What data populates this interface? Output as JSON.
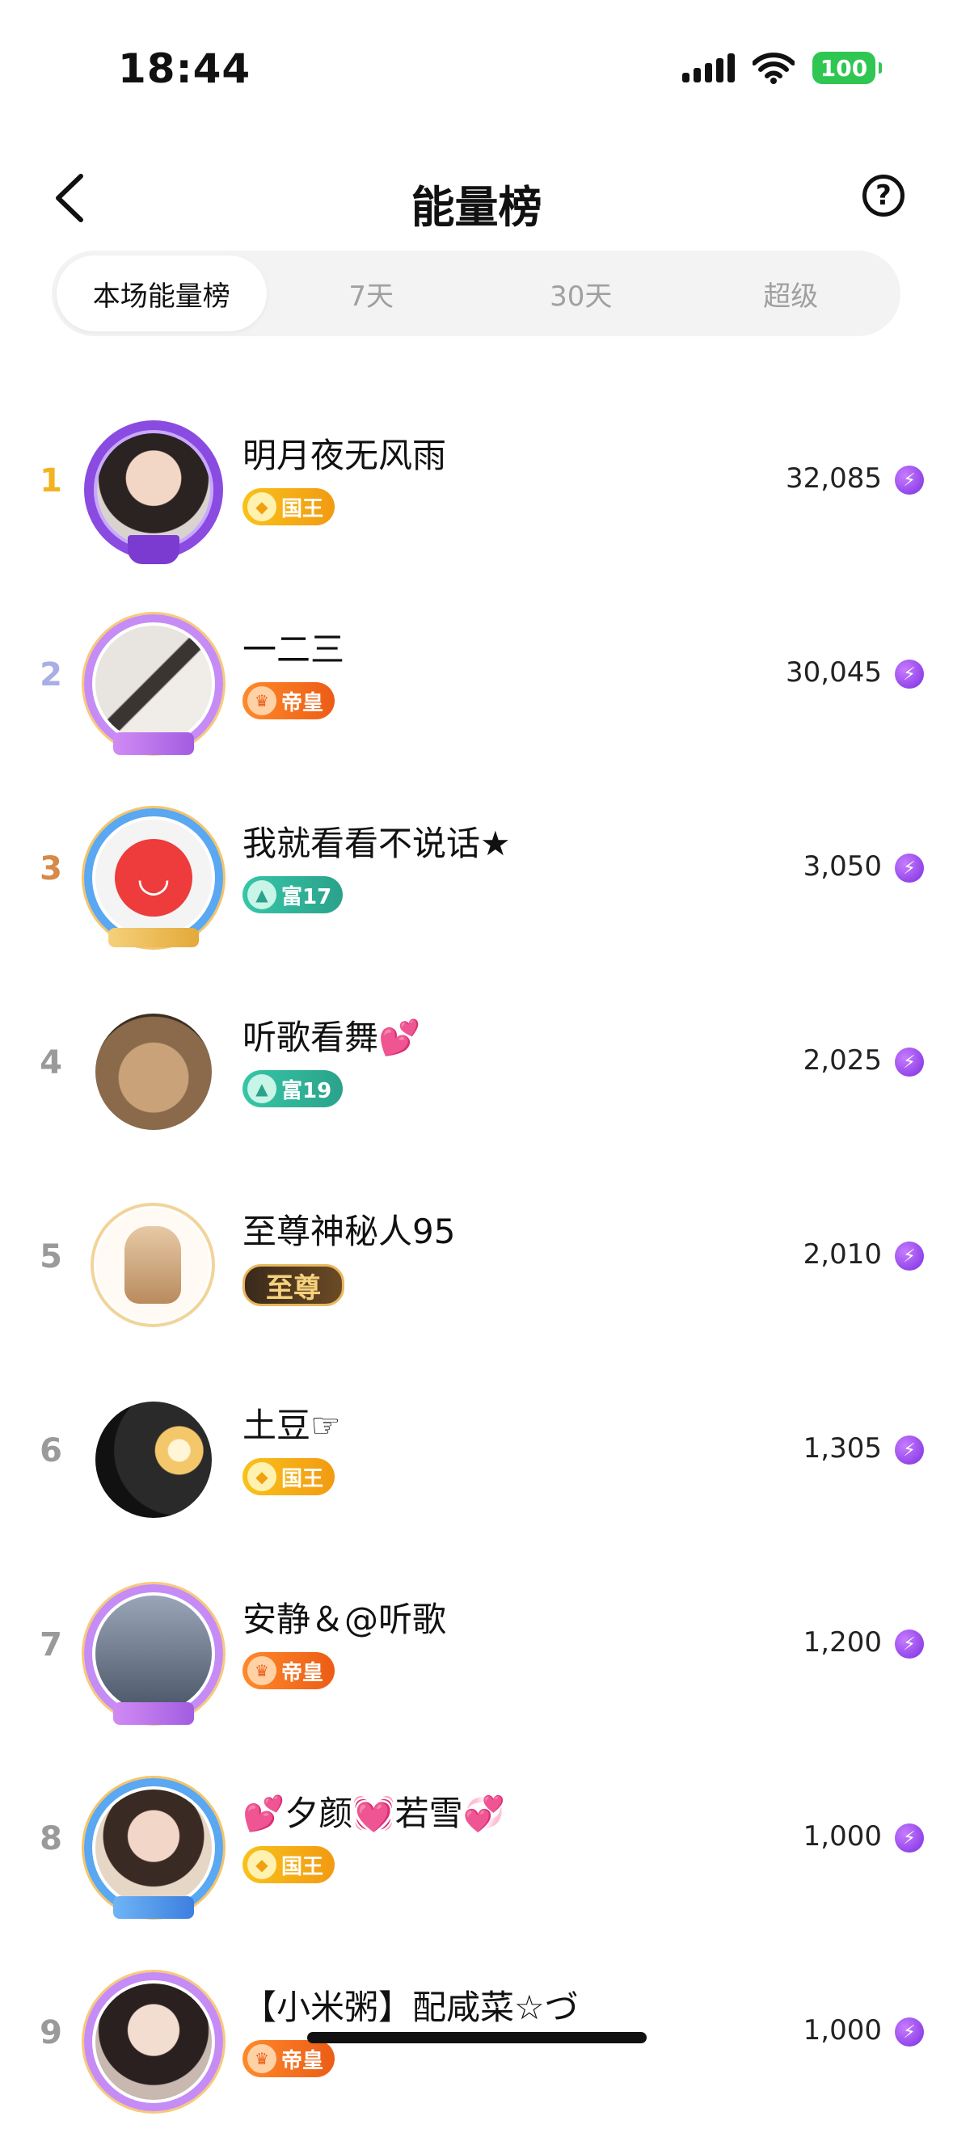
{
  "status_bar": {
    "time": "18:44",
    "battery": "100"
  },
  "header": {
    "title": "能量榜",
    "help_symbol": "?"
  },
  "tabs": [
    {
      "label": "本场能量榜",
      "active": true
    },
    {
      "label": "7天",
      "active": false
    },
    {
      "label": "30天",
      "active": false
    },
    {
      "label": "超级",
      "active": false
    }
  ],
  "ranking": [
    {
      "rank": "1",
      "name": "明月夜无风雨",
      "badge": "国王",
      "badge_type": "king",
      "score": "32,085"
    },
    {
      "rank": "2",
      "name": "一二三",
      "badge": "帝皇",
      "badge_type": "emperor",
      "score": "30,045"
    },
    {
      "rank": "3",
      "name": "我就看看不说话★",
      "badge": "富17",
      "badge_type": "rich",
      "score": "3,050"
    },
    {
      "rank": "4",
      "name": "听歌看舞💕",
      "badge": "富19",
      "badge_type": "rich",
      "score": "2,025"
    },
    {
      "rank": "5",
      "name": "至尊神秘人95",
      "badge": "至尊",
      "badge_type": "supreme",
      "score": "2,010"
    },
    {
      "rank": "6",
      "name": "土豆☞",
      "badge": "国王",
      "badge_type": "king",
      "score": "1,305"
    },
    {
      "rank": "7",
      "name": "安静＆@听歌",
      "badge": "帝皇",
      "badge_type": "emperor",
      "score": "1,200"
    },
    {
      "rank": "8",
      "name": "💕夕颜💓若雪💞",
      "badge": "国王",
      "badge_type": "king",
      "score": "1,000"
    },
    {
      "rank": "9",
      "name": "【小米粥】配咸菜☆づ",
      "badge": "帝皇",
      "badge_type": "emperor",
      "score": "1,000"
    }
  ],
  "colors": {
    "accent_purple": "#7b2ee0",
    "king": "#f29a12",
    "emperor": "#ec5c16",
    "rich": "#2ba28b"
  },
  "icons": {
    "back": "chevron-left-icon",
    "help": "question-circle-icon",
    "energy": "lightning-icon"
  }
}
